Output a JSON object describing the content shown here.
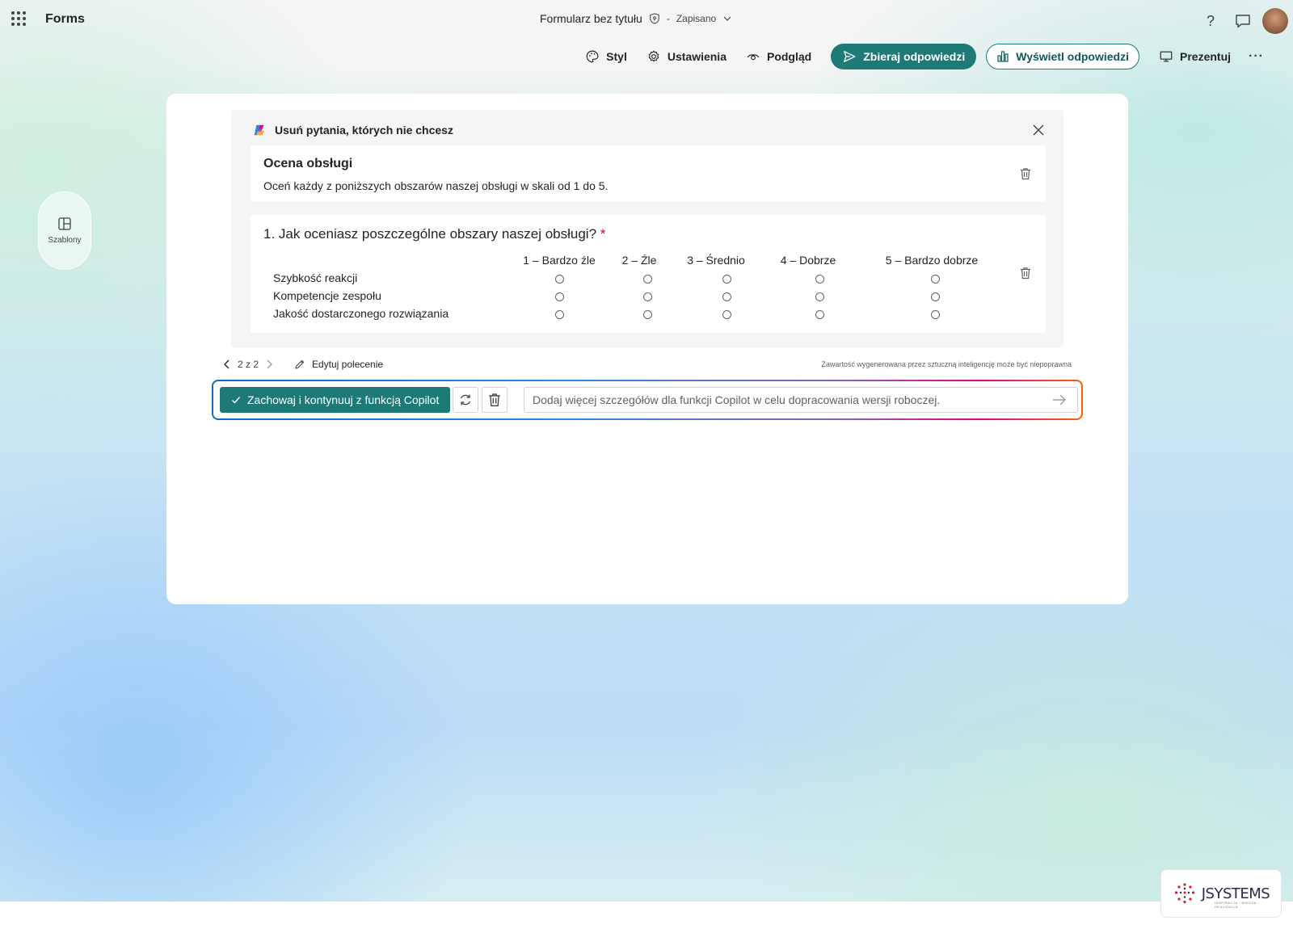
{
  "app": {
    "name": "Forms",
    "form_title": "Formularz bez tytułu",
    "separator": "-",
    "save_status": "Zapisano",
    "help_label": "?"
  },
  "toolbar": {
    "style": "Styl",
    "settings": "Ustawienia",
    "preview": "Podgląd",
    "collect": "Zbieraj odpowiedzi",
    "view_responses": "Wyświetl odpowiedzi",
    "present": "Prezentuj",
    "more": "···"
  },
  "sidebar": {
    "templates": "Szablony"
  },
  "suggestion": {
    "header": "Usuń pytania, których nie chcesz",
    "section": {
      "title": "Ocena obsługi",
      "description": "Oceń każdy z poniższych obszarów naszej obsługi w skali od 1 do 5."
    },
    "question": {
      "text": "1. Jak oceniasz poszczególne obszary naszej obsługi?",
      "required_mark": "*",
      "options": [
        "1 – Bardzo źle",
        "2 – Źle",
        "3 – Średnio",
        "4 – Dobrze",
        "5 – Bardzo dobrze"
      ],
      "statements": [
        "Szybkość reakcji",
        "Kompetencje zespołu",
        "Jakość dostarczonego rozwiązania"
      ]
    }
  },
  "nav": {
    "pager": "2 z 2",
    "edit_prompt": "Edytuj polecenie",
    "disclaimer": "Zawartość wygenerowana przez sztuczną inteligencję może być niepoprawna"
  },
  "prompt": {
    "keep_button": "Zachowaj i kontynuuj z funkcją Copilot",
    "placeholder": "Dodaj więcej szczegółów dla funkcji Copilot w celu dopracowania wersji roboczej."
  },
  "watermark": {
    "brand": "JSYSTEMS",
    "tagline": "INSPIRACJA · WIEDZA · REALIZACJA"
  },
  "colors": {
    "accent": "#1d7a76",
    "required": "#c50f1f"
  }
}
